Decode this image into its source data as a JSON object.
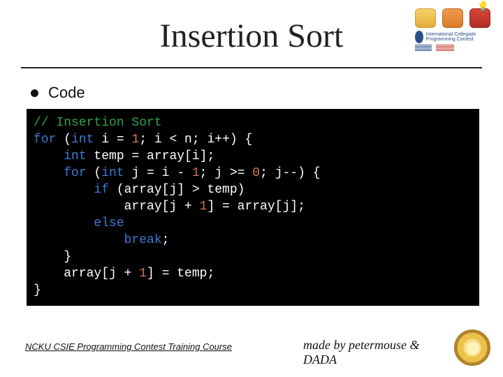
{
  "title": "Insertion Sort",
  "bullet": "Code",
  "code": {
    "l1_comment": "// Insertion Sort",
    "l2_for": "for",
    "l2_a": " (",
    "l2_int": "int",
    "l2_b": " i = ",
    "l2_n1": "1",
    "l2_c": "; i < n; i++) {",
    "l3_a": "    ",
    "l3_int": "int",
    "l3_b": " temp = array[i];",
    "l4_a": "    ",
    "l4_for": "for",
    "l4_b": " (",
    "l4_int": "int",
    "l4_c": " j = i - ",
    "l4_n1": "1",
    "l4_d": "; j >= ",
    "l4_n0": "0",
    "l4_e": "; j--) {",
    "l5_a": "        ",
    "l5_if": "if",
    "l5_b": " (array[j] > temp)",
    "l6": "            array[j + ",
    "l6_n1": "1",
    "l6_b": "] = array[j];",
    "l7_a": "        ",
    "l7_else": "else",
    "l8_a": "            ",
    "l8_break": "break",
    "l8_b": ";",
    "l9": "    }",
    "l10_a": "    array[j + ",
    "l10_n1": "1",
    "l10_b": "] = temp;",
    "l11": "}"
  },
  "footer": {
    "left": " NCKU CSIE Programming Contest Training Course ",
    "right_line1": "made by petermouse &",
    "right_line2": "DADA"
  },
  "logos": {
    "acm_text": "International Collegiate\nProgramming Contest"
  }
}
